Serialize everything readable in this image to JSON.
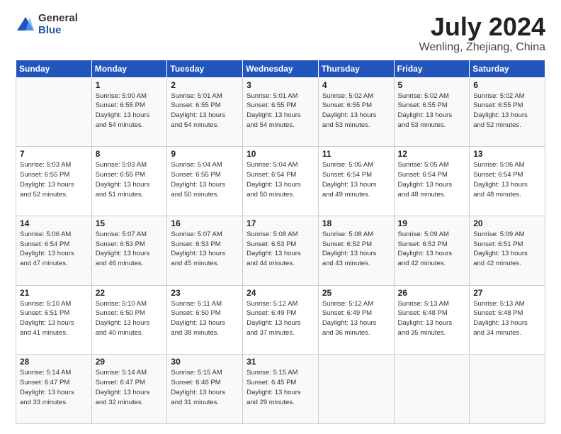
{
  "logo": {
    "general": "General",
    "blue": "Blue"
  },
  "title": "July 2024",
  "subtitle": "Wenling, Zhejiang, China",
  "days_header": [
    "Sunday",
    "Monday",
    "Tuesday",
    "Wednesday",
    "Thursday",
    "Friday",
    "Saturday"
  ],
  "weeks": [
    [
      {
        "num": "",
        "detail": ""
      },
      {
        "num": "1",
        "detail": "Sunrise: 5:00 AM\nSunset: 6:55 PM\nDaylight: 13 hours\nand 54 minutes."
      },
      {
        "num": "2",
        "detail": "Sunrise: 5:01 AM\nSunset: 6:55 PM\nDaylight: 13 hours\nand 54 minutes."
      },
      {
        "num": "3",
        "detail": "Sunrise: 5:01 AM\nSunset: 6:55 PM\nDaylight: 13 hours\nand 54 minutes."
      },
      {
        "num": "4",
        "detail": "Sunrise: 5:02 AM\nSunset: 6:55 PM\nDaylight: 13 hours\nand 53 minutes."
      },
      {
        "num": "5",
        "detail": "Sunrise: 5:02 AM\nSunset: 6:55 PM\nDaylight: 13 hours\nand 53 minutes."
      },
      {
        "num": "6",
        "detail": "Sunrise: 5:02 AM\nSunset: 6:55 PM\nDaylight: 13 hours\nand 52 minutes."
      }
    ],
    [
      {
        "num": "7",
        "detail": "Sunrise: 5:03 AM\nSunset: 6:55 PM\nDaylight: 13 hours\nand 52 minutes."
      },
      {
        "num": "8",
        "detail": "Sunrise: 5:03 AM\nSunset: 6:55 PM\nDaylight: 13 hours\nand 51 minutes."
      },
      {
        "num": "9",
        "detail": "Sunrise: 5:04 AM\nSunset: 6:55 PM\nDaylight: 13 hours\nand 50 minutes."
      },
      {
        "num": "10",
        "detail": "Sunrise: 5:04 AM\nSunset: 6:54 PM\nDaylight: 13 hours\nand 50 minutes."
      },
      {
        "num": "11",
        "detail": "Sunrise: 5:05 AM\nSunset: 6:54 PM\nDaylight: 13 hours\nand 49 minutes."
      },
      {
        "num": "12",
        "detail": "Sunrise: 5:05 AM\nSunset: 6:54 PM\nDaylight: 13 hours\nand 48 minutes."
      },
      {
        "num": "13",
        "detail": "Sunrise: 5:06 AM\nSunset: 6:54 PM\nDaylight: 13 hours\nand 48 minutes."
      }
    ],
    [
      {
        "num": "14",
        "detail": "Sunrise: 5:06 AM\nSunset: 6:54 PM\nDaylight: 13 hours\nand 47 minutes."
      },
      {
        "num": "15",
        "detail": "Sunrise: 5:07 AM\nSunset: 6:53 PM\nDaylight: 13 hours\nand 46 minutes."
      },
      {
        "num": "16",
        "detail": "Sunrise: 5:07 AM\nSunset: 6:53 PM\nDaylight: 13 hours\nand 45 minutes."
      },
      {
        "num": "17",
        "detail": "Sunrise: 5:08 AM\nSunset: 6:53 PM\nDaylight: 13 hours\nand 44 minutes."
      },
      {
        "num": "18",
        "detail": "Sunrise: 5:08 AM\nSunset: 6:52 PM\nDaylight: 13 hours\nand 43 minutes."
      },
      {
        "num": "19",
        "detail": "Sunrise: 5:09 AM\nSunset: 6:52 PM\nDaylight: 13 hours\nand 42 minutes."
      },
      {
        "num": "20",
        "detail": "Sunrise: 5:09 AM\nSunset: 6:51 PM\nDaylight: 13 hours\nand 42 minutes."
      }
    ],
    [
      {
        "num": "21",
        "detail": "Sunrise: 5:10 AM\nSunset: 6:51 PM\nDaylight: 13 hours\nand 41 minutes."
      },
      {
        "num": "22",
        "detail": "Sunrise: 5:10 AM\nSunset: 6:50 PM\nDaylight: 13 hours\nand 40 minutes."
      },
      {
        "num": "23",
        "detail": "Sunrise: 5:11 AM\nSunset: 6:50 PM\nDaylight: 13 hours\nand 38 minutes."
      },
      {
        "num": "24",
        "detail": "Sunrise: 5:12 AM\nSunset: 6:49 PM\nDaylight: 13 hours\nand 37 minutes."
      },
      {
        "num": "25",
        "detail": "Sunrise: 5:12 AM\nSunset: 6:49 PM\nDaylight: 13 hours\nand 36 minutes."
      },
      {
        "num": "26",
        "detail": "Sunrise: 5:13 AM\nSunset: 6:48 PM\nDaylight: 13 hours\nand 35 minutes."
      },
      {
        "num": "27",
        "detail": "Sunrise: 5:13 AM\nSunset: 6:48 PM\nDaylight: 13 hours\nand 34 minutes."
      }
    ],
    [
      {
        "num": "28",
        "detail": "Sunrise: 5:14 AM\nSunset: 6:47 PM\nDaylight: 13 hours\nand 33 minutes."
      },
      {
        "num": "29",
        "detail": "Sunrise: 5:14 AM\nSunset: 6:47 PM\nDaylight: 13 hours\nand 32 minutes."
      },
      {
        "num": "30",
        "detail": "Sunrise: 5:15 AM\nSunset: 6:46 PM\nDaylight: 13 hours\nand 31 minutes."
      },
      {
        "num": "31",
        "detail": "Sunrise: 5:15 AM\nSunset: 6:45 PM\nDaylight: 13 hours\nand 29 minutes."
      },
      {
        "num": "",
        "detail": ""
      },
      {
        "num": "",
        "detail": ""
      },
      {
        "num": "",
        "detail": ""
      }
    ]
  ]
}
